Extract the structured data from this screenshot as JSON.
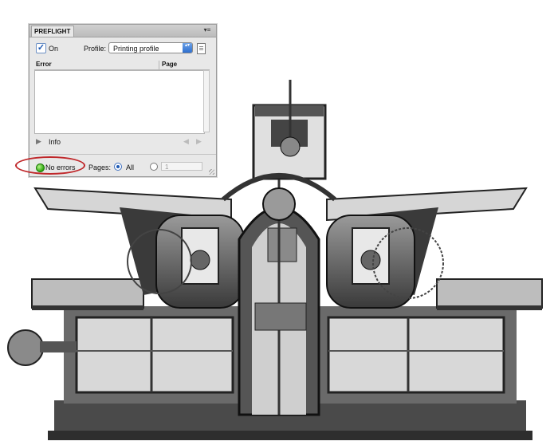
{
  "illustration": {
    "description_name": "printing-press-photo"
  },
  "panel": {
    "tab_title": "PREFLIGHT",
    "menu_glyph": "▾≡",
    "on_checked": true,
    "check_glyph": "✓",
    "on_label": "On",
    "profile_label": "Profile:",
    "profile_value": "Printing profile",
    "select_arrow_glyph": "▴▾",
    "columns": {
      "error": "Error",
      "page": "Page"
    },
    "info_arrow_glyph": "▶",
    "info_label": "Info",
    "nav_prev_glyph": "◀",
    "nav_next_glyph": "▶",
    "status": {
      "text": "No errors",
      "color": "#2ea80f"
    },
    "pages_label": "Pages:",
    "all_label": "All",
    "page_range_value": "1"
  },
  "annotation": {
    "color": "#c0282b"
  }
}
